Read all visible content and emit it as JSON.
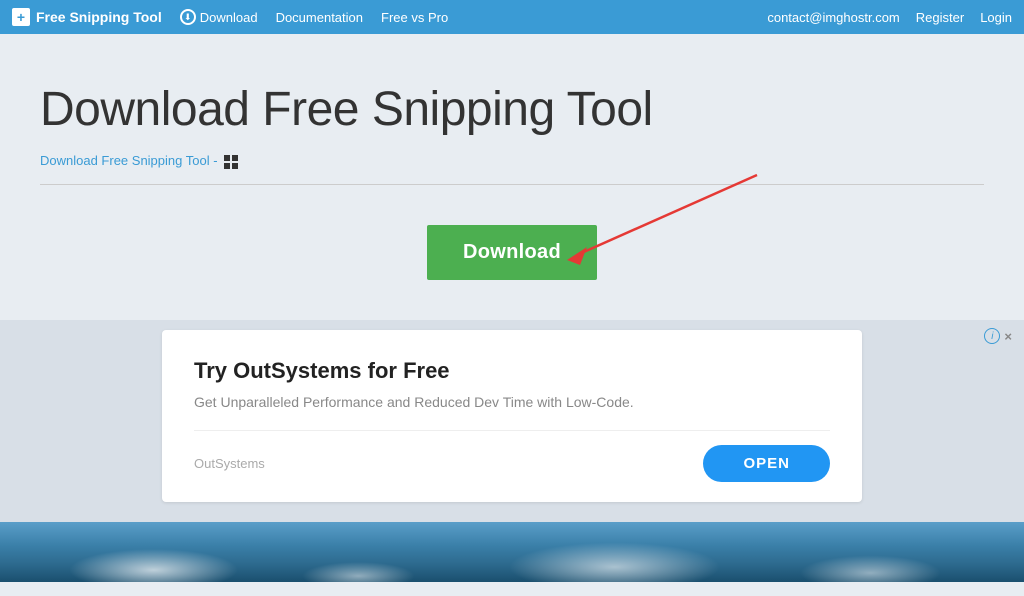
{
  "navbar": {
    "brand_label": "Free Snipping Tool",
    "brand_icon_symbol": "+",
    "download_label": "Download",
    "download_icon": "⬇",
    "docs_label": "Documentation",
    "freevspro_label": "Free vs Pro",
    "contact_email": "contact@imghostr.com",
    "register_label": "Register",
    "login_label": "Login"
  },
  "page": {
    "title": "Download Free Snipping Tool",
    "breadcrumb_text": "Download Free Snipping Tool -",
    "download_button_label": "Download"
  },
  "ad": {
    "info_icon": "i",
    "close_icon": "×",
    "title": "Try OutSystems for Free",
    "subtitle": "Get Unparalleled Performance and Reduced Dev Time with Low-Code.",
    "brand_name": "OutSystems",
    "open_button_label": "OPEN"
  }
}
